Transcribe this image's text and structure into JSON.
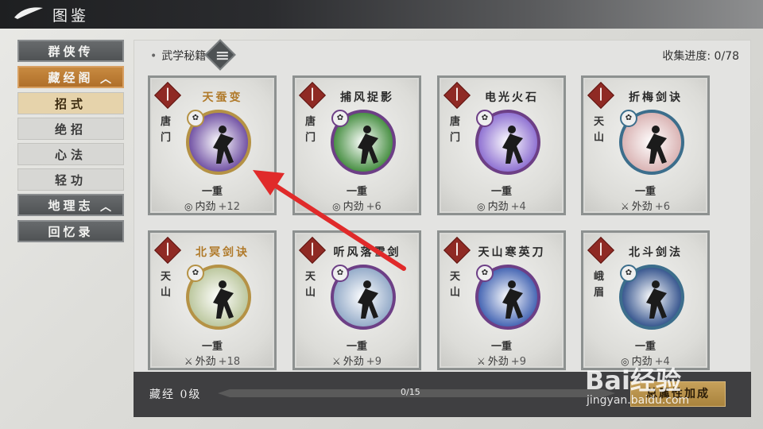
{
  "header": {
    "title": "图鉴"
  },
  "sidebar": {
    "items": [
      {
        "label": "群侠传"
      },
      {
        "label": "藏经阁",
        "chevron": "︿"
      },
      {
        "label": "地理志",
        "chevron": "︿"
      },
      {
        "label": "回忆录"
      }
    ],
    "sub_items": [
      {
        "label": "招式",
        "active": true
      },
      {
        "label": "绝招"
      },
      {
        "label": "心法"
      },
      {
        "label": "轻功"
      }
    ]
  },
  "main": {
    "category": "武学秘籍",
    "progress": "收集进度: 0/78",
    "cards": [
      {
        "name": "天蚕变",
        "school": "唐门",
        "rank": "一重",
        "stat_icon": "spiral-icon",
        "stat": "内劲",
        "bonus": "+12",
        "name_color": "#b07a2a",
        "ring": "#b59245",
        "bg": "#6b4aa0"
      },
      {
        "name": "捕风捉影",
        "school": "唐门",
        "rank": "一重",
        "stat_icon": "spiral-icon",
        "stat": "内劲",
        "bonus": "+6",
        "name_color": "#2a2a2a",
        "ring": "#6d3f86",
        "bg": "#3f8a3a"
      },
      {
        "name": "电光火石",
        "school": "唐门",
        "rank": "一重",
        "stat_icon": "spiral-icon",
        "stat": "内劲",
        "bonus": "+4",
        "name_color": "#2a2a2a",
        "ring": "#6d3f86",
        "bg": "#8a6bd0"
      },
      {
        "name": "折梅剑诀",
        "school": "天山",
        "rank": "一重",
        "stat_icon": "sword-icon",
        "stat": "外劲",
        "bonus": "+6",
        "name_color": "#2a2a2a",
        "ring": "#3c6e8c",
        "bg": "#d8b0b0"
      },
      {
        "name": "北冥剑诀",
        "school": "天山",
        "rank": "一重",
        "stat_icon": "sword-icon",
        "stat": "外劲",
        "bonus": "+18",
        "name_color": "#b07a2a",
        "ring": "#b59245",
        "bg": "#b9c59a"
      },
      {
        "name": "听风落雪剑",
        "school": "天山",
        "rank": "一重",
        "stat_icon": "sword-icon",
        "stat": "外劲",
        "bonus": "+9",
        "name_color": "#2a2a2a",
        "ring": "#6d3f86",
        "bg": "#8fa7c6"
      },
      {
        "name": "天山寒英刀",
        "school": "天山",
        "rank": "一重",
        "stat_icon": "sword-icon",
        "stat": "外劲",
        "bonus": "+9",
        "name_color": "#2a2a2a",
        "ring": "#6d3f86",
        "bg": "#3d5fb0"
      },
      {
        "name": "北斗剑法",
        "school": "峨眉",
        "rank": "一重",
        "stat_icon": "spiral-icon",
        "stat": "内劲",
        "bonus": "+4",
        "name_color": "#2a2a2a",
        "ring": "#3c6e8c",
        "bg": "#2f4f8a"
      }
    ]
  },
  "footer": {
    "level": "藏经 0级",
    "progress_text": "0/15",
    "progress_fraction": 0,
    "bonus_button": "总属性加成"
  },
  "watermark": {
    "main": "Bai经验",
    "url": "jingyan.baidu.com"
  },
  "colors": {
    "accent": "#c88a40",
    "annotation_arrow": "#e02a2a"
  }
}
